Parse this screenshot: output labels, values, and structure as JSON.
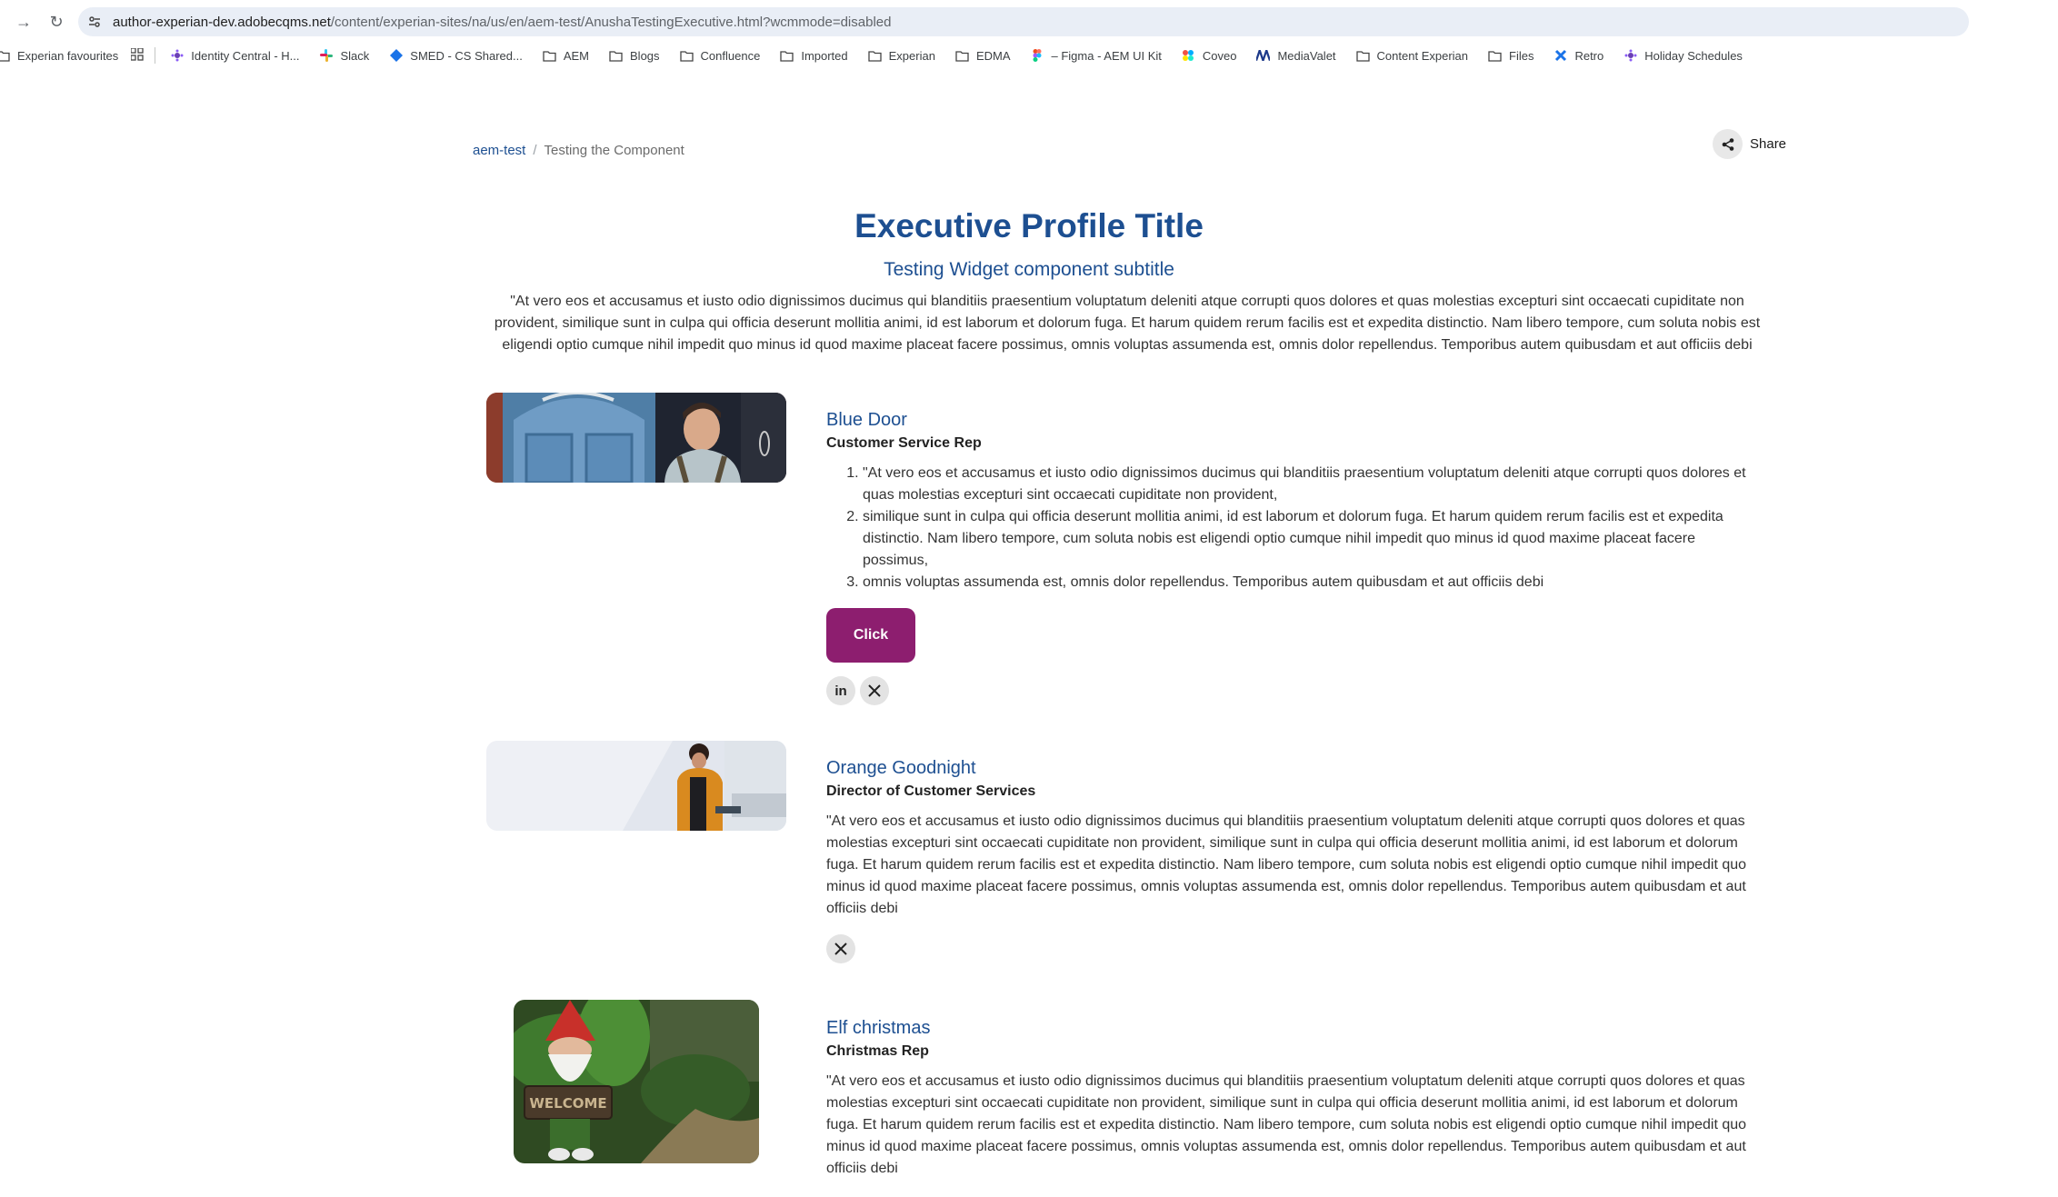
{
  "browser": {
    "url_host": "author-experian-dev.adobecqms.net",
    "url_path": "/content/experian-sites/na/us/en/aem-test/AnushaTestingExecutive.html?wcmmode=disabled",
    "bookmarks": [
      {
        "label": "Experian favourites",
        "icon": "folder-icon"
      },
      {
        "label": "Identity Central - H...",
        "icon": "app-icon"
      },
      {
        "label": "Slack",
        "icon": "slack-icon"
      },
      {
        "label": "SMED - CS Shared...",
        "icon": "diamond-icon"
      },
      {
        "label": "AEM",
        "icon": "folder-icon"
      },
      {
        "label": "Blogs",
        "icon": "folder-icon"
      },
      {
        "label": "Confluence",
        "icon": "folder-icon"
      },
      {
        "label": "Imported",
        "icon": "folder-icon"
      },
      {
        "label": "Experian",
        "icon": "folder-icon"
      },
      {
        "label": "EDMA",
        "icon": "folder-icon"
      },
      {
        "label": "– Figma - AEM UI Kit",
        "icon": "figma-icon"
      },
      {
        "label": "Coveo",
        "icon": "coveo-icon"
      },
      {
        "label": "MediaValet",
        "icon": "mediavalet-icon"
      },
      {
        "label": "Content Experian",
        "icon": "folder-icon"
      },
      {
        "label": "Files",
        "icon": "folder-icon"
      },
      {
        "label": "Retro",
        "icon": "retro-icon"
      },
      {
        "label": "Holiday Schedules",
        "icon": "app-icon"
      }
    ]
  },
  "breadcrumb": {
    "parent": "aem-test",
    "current": "Testing the Component"
  },
  "share_label": "Share",
  "page": {
    "title": "Executive Profile Title",
    "subtitle": "Testing Widget component subtitle",
    "intro": "\"At vero eos et accusamus et iusto odio dignissimos ducimus qui blanditiis praesentium voluptatum deleniti atque corrupti quos dolores et quas molestias excepturi sint occaecati cupiditate non provident, similique sunt in culpa qui officia deserunt mollitia animi, id est laborum et dolorum fuga. Et harum quidem rerum facilis est et expedita distinctio. Nam libero tempore, cum soluta nobis est eligendi optio cumque nihil impedit quo minus id quod maxime placeat facere possimus, omnis voluptas assumenda est, omnis dolor repellendus. Temporibus autem quibusdam et aut officiis debi"
  },
  "profiles": [
    {
      "name": "Blue Door",
      "role": "Customer Service Rep",
      "list": [
        "\"At vero eos et accusamus et iusto odio dignissimos ducimus qui blanditiis praesentium voluptatum deleniti atque corrupti quos dolores et quas molestias excepturi sint occaecati cupiditate non provident,",
        " similique sunt in culpa qui officia deserunt mollitia animi, id est laborum et dolorum fuga. Et harum quidem rerum facilis est et expedita distinctio. Nam libero tempore, cum soluta nobis est eligendi optio cumque nihil impedit quo minus id quod maxime placeat facere possimus,",
        "omnis voluptas assumenda est, omnis dolor repellendus. Temporibus autem quibusdam et aut officiis debi"
      ],
      "button_label": "Click",
      "socials": [
        "linkedin-icon",
        "x-icon"
      ]
    },
    {
      "name": "Orange Goodnight",
      "role": "Director of Customer Services",
      "body": "\"At vero eos et accusamus et iusto odio dignissimos ducimus qui blanditiis praesentium voluptatum deleniti atque corrupti quos dolores et quas molestias excepturi sint occaecati cupiditate non provident, similique sunt in culpa qui officia deserunt mollitia animi, id est laborum et dolorum fuga. Et harum quidem rerum facilis est et expedita distinctio. Nam libero tempore, cum soluta nobis est eligendi optio cumque nihil impedit quo minus id quod maxime placeat facere possimus, omnis voluptas assumenda est, omnis dolor repellendus. Temporibus autem quibusdam et aut officiis debi",
      "socials": [
        "x-icon"
      ]
    },
    {
      "name": "Elf christmas",
      "role": "Christmas Rep",
      "body": "\"At vero eos et accusamus et iusto odio dignissimos ducimus qui blanditiis praesentium voluptatum deleniti atque corrupti quos dolores et quas molestias excepturi sint occaecati cupiditate non provident, similique sunt in culpa qui officia deserunt mollitia animi, id est laborum et dolorum fuga. Et harum quidem rerum facilis est et expedita distinctio. Nam libero tempore, cum soluta nobis est eligendi optio cumque nihil impedit quo minus id quod maxime placeat facere possimus, omnis voluptas assumenda est, omnis dolor repellendus. Temporibus autem quibusdam et aut officiis debi",
      "gnome_sign": "WELCOME"
    }
  ],
  "colors": {
    "brand_blue": "#1d4f91",
    "button_purple": "#8d1e6f"
  }
}
